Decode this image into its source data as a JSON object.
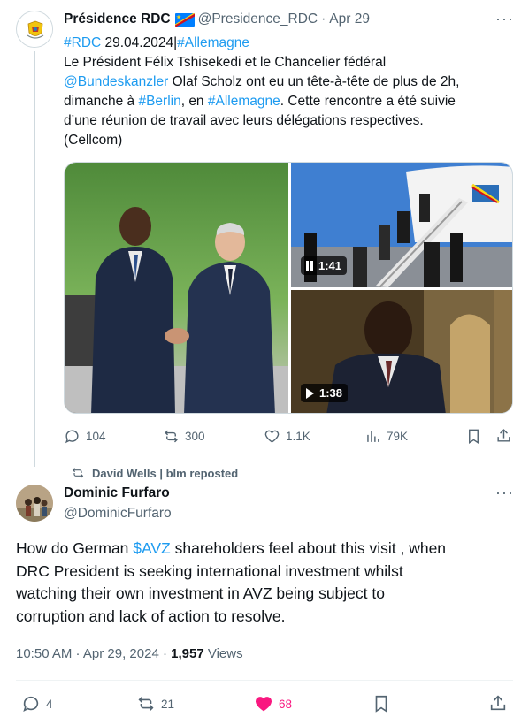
{
  "tweet1": {
    "name": "Présidence RDC",
    "flag": "drc-flag-emoji",
    "handle": "@Presidence_RDC",
    "sep": "·",
    "date": "Apr 29",
    "more": "···",
    "lines": [
      [
        "#RDC",
        " 29.04.2024|",
        "#Allemagne"
      ],
      "Le Président Félix Tshisekedi et le Chancelier fédéral",
      [
        "@Bundeskanzler",
        " Olaf Scholz ont eu un tête-à-tête de plus de 2h,"
      ],
      [
        "dimanche à ",
        "#Berlin",
        ", en ",
        "#Allemagne",
        ". Cette rencontre a été suivie"
      ],
      "d’une réunion de travail avec leurs délégations respectives.",
      "(Cellcom)"
    ],
    "media": {
      "video1_duration": "1:41",
      "video2_duration": "1:38"
    },
    "stats": {
      "replies": "104",
      "reposts": "300",
      "likes": "1.1K",
      "views": "79K"
    }
  },
  "repost_note": "David Wells | blm reposted",
  "tweet2": {
    "name": "Dominic Furfaro",
    "handle": "@DominicFurfaro",
    "more": "···",
    "lines": [
      [
        "How do German ",
        "$AVZ",
        " shareholders feel about this visit , when"
      ],
      "DRC President is seeking international investment whilst",
      "watching their own investment in AVZ being subject to",
      "corruption and lack of action to resolve."
    ],
    "time": "10:50 AM",
    "sep": " · ",
    "date": "Apr 29, 2024",
    "views_count": "1,957",
    "views_label": " Views",
    "stats": {
      "replies": "4",
      "reposts": "21",
      "likes": "68"
    },
    "like_color": "#f91880"
  }
}
